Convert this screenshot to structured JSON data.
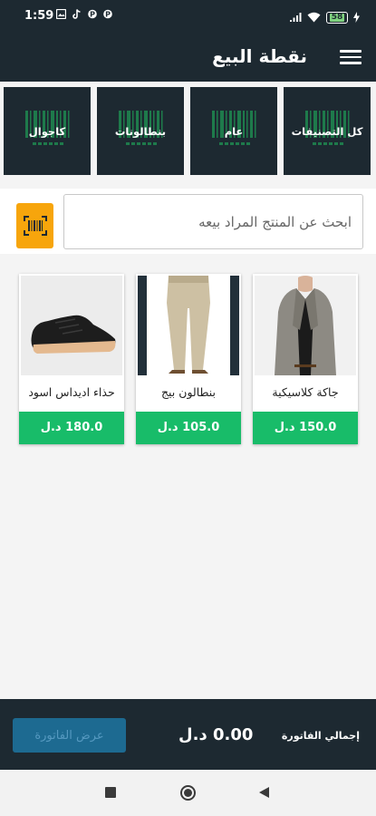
{
  "status_bar": {
    "time": "1:59",
    "notification_icons": [
      "gallery-icon",
      "tiktok-icon",
      "p-icon",
      "p-icon"
    ],
    "battery": "58"
  },
  "app_bar": {
    "title": "نقطة البيع",
    "menu_icon": "hamburger-menu-icon"
  },
  "categories": [
    {
      "label": "كل التصنيفات"
    },
    {
      "label": "عام"
    },
    {
      "label": "بنطالونات"
    },
    {
      "label": "كاجوال"
    }
  ],
  "search": {
    "placeholder": "ابحث عن المنتج المراد بيعه",
    "value": "",
    "scan_icon": "barcode-scanner-icon"
  },
  "products": [
    {
      "name": "جاكة كلاسيكية",
      "price": "150.0 د.ل",
      "image": "blazer-jacket-photo"
    },
    {
      "name": "بنطالون بيج",
      "price": "105.0 د.ل",
      "image": "beige-trousers-photo"
    },
    {
      "name": "حذاء اديداس اسود",
      "price": "180.0 د.ل",
      "image": "black-sneaker-photo"
    }
  ],
  "bottom_bar": {
    "total_label": "إجمالي الفاتورة",
    "total_value": "0.00 د.ل",
    "invoice_button": "عرض الفاتورة"
  },
  "colors": {
    "primary_dark": "#1d2931",
    "price_green": "#18bc69",
    "scan_orange": "#f7a50c",
    "invoice_button": "#1d6a91"
  }
}
